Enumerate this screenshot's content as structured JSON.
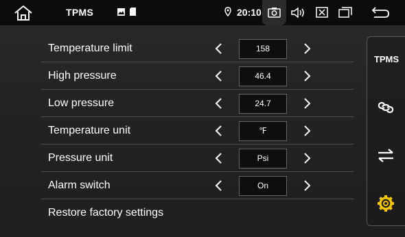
{
  "status_bar": {
    "title": "TPMS",
    "time": "20:10",
    "icons": [
      "home-icon",
      "gallery-icon",
      "sd-card-icon",
      "location-icon",
      "camera-icon",
      "volume-icon",
      "close-box-icon",
      "windows-icon",
      "back-icon"
    ]
  },
  "settings": [
    {
      "label": "Temperature limit",
      "value": "158"
    },
    {
      "label": "High pressure",
      "value": "46.4"
    },
    {
      "label": "Low pressure",
      "value": "24.7"
    },
    {
      "label": "Temperature unit",
      "value": "℉"
    },
    {
      "label": "Pressure unit",
      "value": "Psi"
    },
    {
      "label": "Alarm switch",
      "value": "On"
    }
  ],
  "restore_label": "Restore factory settings",
  "sidebar": {
    "tpms_label": "TPMS",
    "icons": [
      "link-icon",
      "swap-icon",
      "gear-icon"
    ]
  },
  "colors": {
    "statusbar_bg": "#0c0c0c",
    "accent_gear": "#f5c400",
    "value_box_bg": "#0e0e0e"
  }
}
